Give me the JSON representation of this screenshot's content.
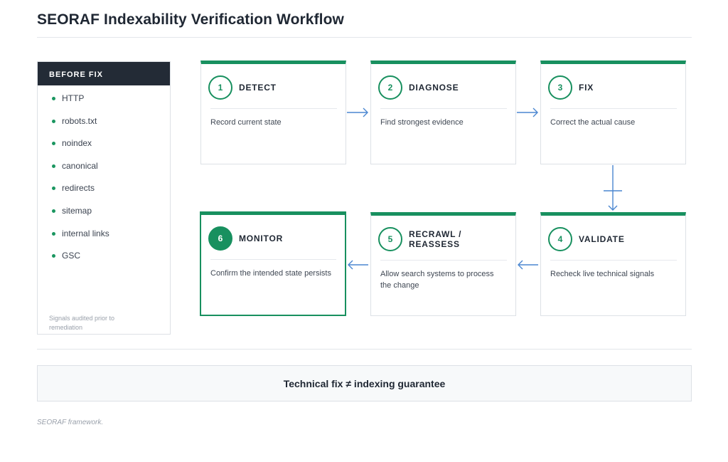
{
  "page": {
    "title": "SEORAF Indexability Verification Workflow"
  },
  "sidebar": {
    "header": "BEFORE FIX",
    "items": [
      {
        "label": "HTTP"
      },
      {
        "label": "robots.txt"
      },
      {
        "label": "noindex"
      },
      {
        "label": "canonical"
      },
      {
        "label": "redirects"
      },
      {
        "label": "sitemap"
      },
      {
        "label": "internal links"
      },
      {
        "label": "GSC"
      }
    ],
    "note": "Signals audited prior to remediation"
  },
  "steps": [
    {
      "number": "1",
      "title": "DETECT",
      "description": "Record current state"
    },
    {
      "number": "2",
      "title": "DIAGNOSE",
      "description": "Find strongest evidence"
    },
    {
      "number": "3",
      "title": "FIX",
      "description": "Correct the actual cause"
    },
    {
      "number": "4",
      "title": "VALIDATE",
      "description": "Recheck live technical signals"
    },
    {
      "number": "5",
      "title": "RECRAWL / REASSESS",
      "description": "Allow search systems to process the change"
    },
    {
      "number": "6",
      "title": "MONITOR",
      "description": "Confirm the intended state persists",
      "active": true
    }
  ],
  "banner": {
    "text": "Technical fix ≠ indexing guarantee"
  },
  "footnote": "SEORAF framework.",
  "colors": {
    "accent": "#18905f",
    "arrow": "#4a86d0",
    "sidebar_header_bg": "#232b36"
  }
}
